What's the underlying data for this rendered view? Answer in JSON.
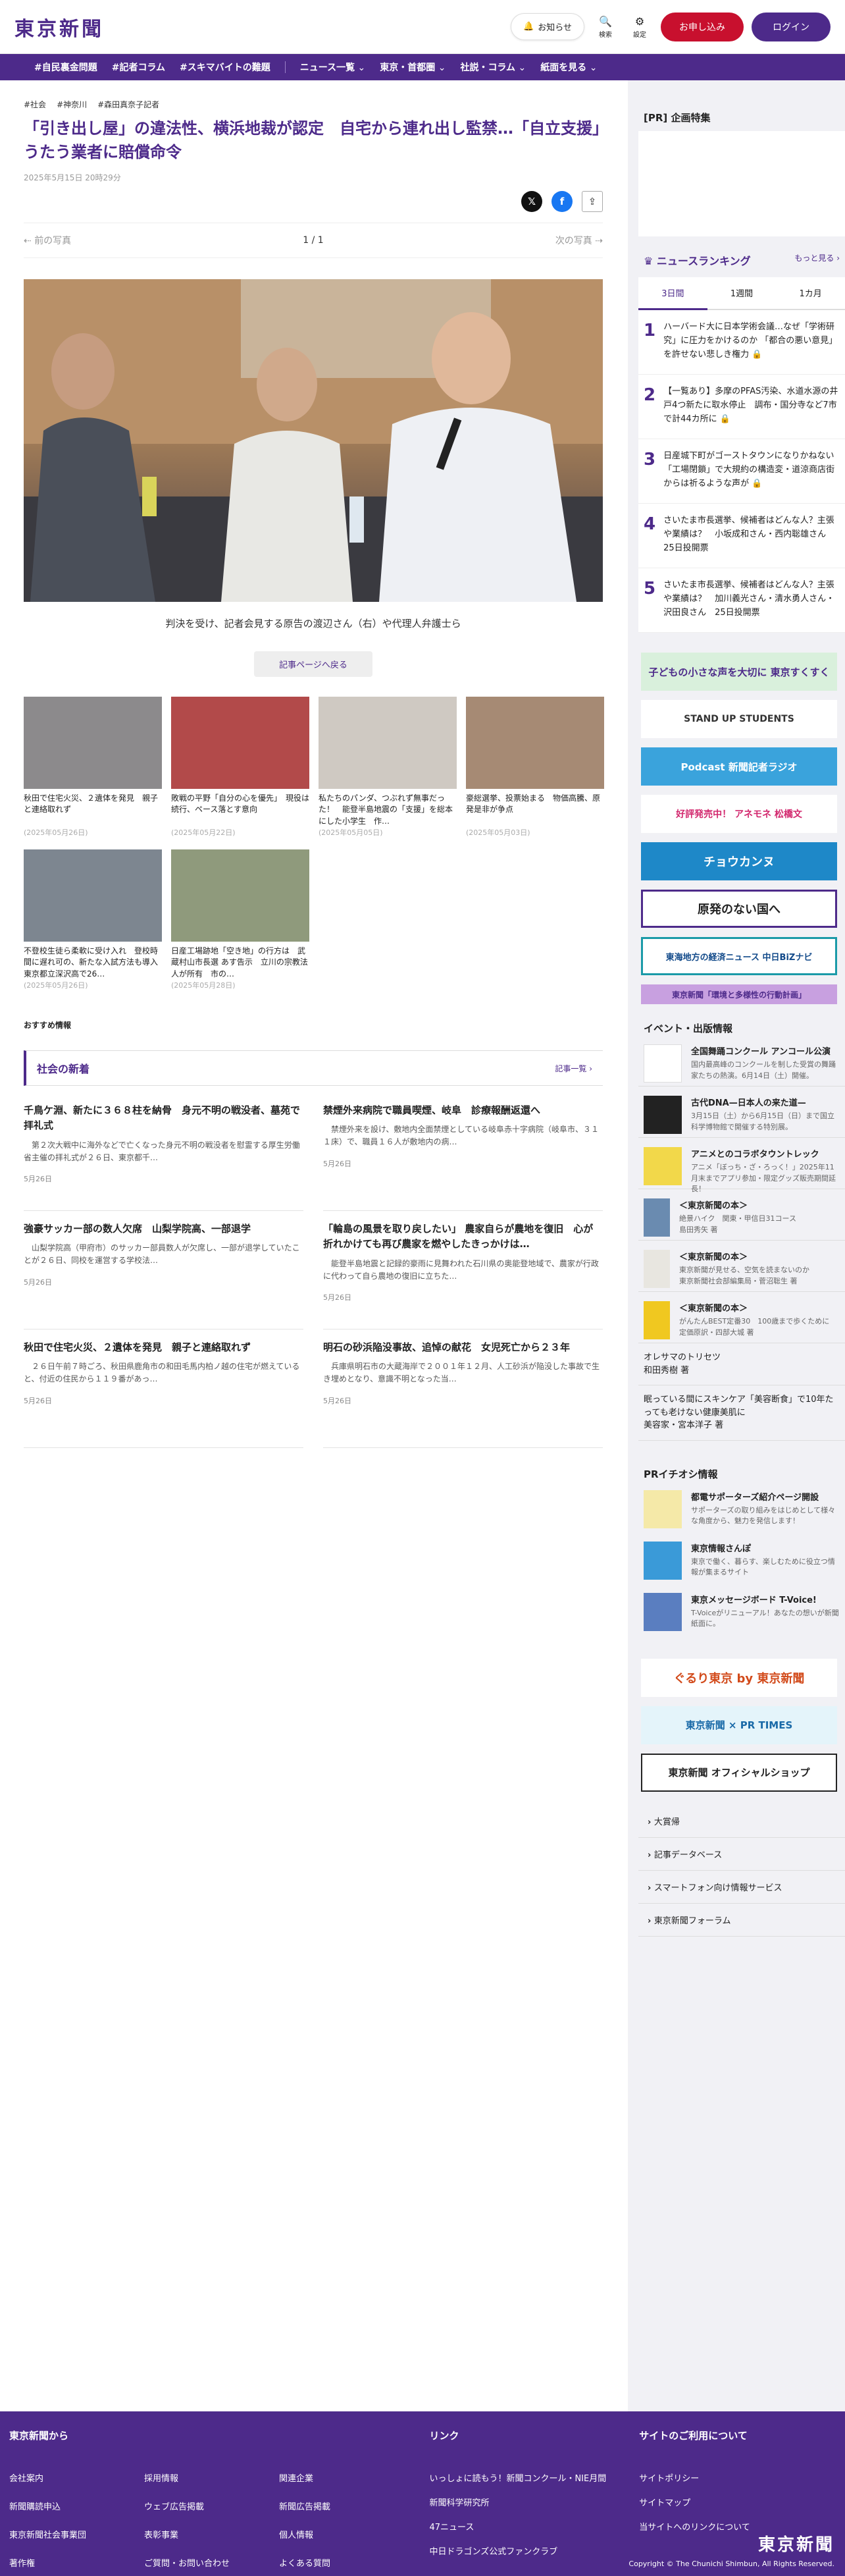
{
  "header": {
    "logo": "東京新聞",
    "notice": "お知らせ",
    "search": "検索",
    "settings": "設定",
    "apply": "お申し込み",
    "login": "ログイン"
  },
  "nav": {
    "items": [
      "#自民裏金問題",
      "#記者コラム",
      "#スキマバイトの難題",
      "ニュース一覧",
      "東京・首都圏",
      "社説・コラム",
      "紙面を見る"
    ]
  },
  "article": {
    "tags": [
      "#社会",
      "#神奈川",
      "#森田真奈子記者"
    ],
    "title": "「引き出し屋」の違法性、横浜地裁が認定　自宅から連れ出し監禁…「自立支援」うたう業者に賠償命令",
    "date": "2025年5月15日 20時29分",
    "prev": "前の写真",
    "next": "次の写真",
    "page": "1 / 1",
    "caption": "判決を受け、記者会見する原告の渡辺さん（右）や代理人弁護士ら",
    "back": "記事ページへ戻る",
    "related": [
      {
        "title": "秋田で住宅火災、２遺体を発見　親子と連絡取れず",
        "date": "(2025年05月26日)"
      },
      {
        "title": "敗戦の平野「自分の心を優先」　現役は続行、ペース落とす意向",
        "date": "(2025年05月22日)"
      },
      {
        "title": "私たちのパンダ、つぶれず無事だった！　能登半島地震の「支援」を総本にした小学生　作…",
        "date": "(2025年05月05日)"
      },
      {
        "title": "豪総選挙、投票始まる　物価高騰、原発是非が争点",
        "date": "(2025年05月03日)"
      },
      {
        "title": "不登校生徒ら柔軟に受け入れ　登校時間に遅れ可の、新たな入試方法も導入　東京都立深沢高で26…",
        "date": "(2025年05月26日)"
      },
      {
        "title": "日産工場跡地「空き地」の行方は　武蔵村山市長選 あす告示　立川の宗教法人が所有　市の…",
        "date": "(2025年05月28日)"
      }
    ],
    "recommend": "おすすめ情報"
  },
  "latest": {
    "heading": "社会の新着",
    "more": "記事一覧",
    "items": [
      {
        "title": "千鳥ケ淵、新たに３６８柱を納骨　身元不明の戦没者、墓苑で拝礼式",
        "body": "　第２次大戦中に海外などで亡くなった身元不明の戦没者を慰霊する厚生労働省主催の拝礼式が２６日、東京都千…",
        "date": "5月26日"
      },
      {
        "title": "禁煙外来病院で職員喫煙、岐阜　診療報酬返還へ",
        "body": "　禁煙外来を設け、敷地内全面禁煙としている岐阜赤十字病院（岐阜市、３１１床）で、職員１６人が敷地内の病…",
        "date": "5月26日"
      },
      {
        "title": "強豪サッカー部の数人欠席　山梨学院高、一部退学",
        "body": "　山梨学院高（甲府市）のサッカー部員数人が欠席し、一部が退学していたことが２６日、同校を運営する学校法…",
        "date": "5月26日"
      },
      {
        "title": "「輪島の風景を取り戻したい」 農家自らが農地を復旧　心が折れかけても再び農家を燃やしたきっかけは…",
        "body": "　能登半島地震と記録的豪雨に見舞われた石川県の奥能登地域で、農家が行政に代わって自ら農地の復旧に立ちた…",
        "date": "5月26日"
      },
      {
        "title": "秋田で住宅火災、２遺体を発見　親子と連絡取れず",
        "body": "　２６日午前７時ごろ、秋田県鹿角市の和田毛馬内柏ノ越の住宅が燃えていると、付近の住民から１１９番があっ…",
        "date": "5月26日"
      },
      {
        "title": "明石の砂浜陥没事故、追悼の献花　女児死亡から２３年",
        "body": "　兵庫県明石市の大蔵海岸で２００１年１２月、人工砂浜が陥没した事故で生き埋めとなり、意識不明となった当…",
        "date": "5月26日"
      }
    ]
  },
  "sidebar": {
    "pr_heading": "[PR] 企画特集",
    "ranking_heading": "ニュースランキング",
    "ranking_more": "もっと見る",
    "tabs": [
      "3日間",
      "1週間",
      "1カ月"
    ],
    "ranking": [
      {
        "n": "1",
        "title": "ハーバード大に日本学術会議…なぜ「学術研究」に圧力をかけるのか 「都合の悪い意見」を許せない悲しき権力 🔒"
      },
      {
        "n": "2",
        "title": "【一覧あり】多摩のPFAS汚染、水道水源の井戸4つ新たに取水停止　調布・国分寺など7市で計44カ所に 🔒"
      },
      {
        "n": "3",
        "title": "日産城下町がゴーストタウンになりかねない 「工場閉鎖」で大規約の構造変・道涼商店街からは祈るような声が 🔒"
      },
      {
        "n": "4",
        "title": "さいたま市長選挙、候補者はどんな人？主張や業績は？　小坂成和さん・西内聡雄さん　25日投開票"
      },
      {
        "n": "5",
        "title": "さいたま市長選挙、候補者はどんな人？主張や業績は？　加川義光さん・清水勇人さん・沢田良さん　25日投開票"
      }
    ],
    "banners": [
      "子どもの小さな声を大切に 東京すくすく",
      "STAND UP STUDENTS",
      "Podcast 新聞記者ラジオ",
      "好評発売中！ アネモネ 松橋文",
      "チョウカンヌ",
      "原発のない国へ",
      "東海地方の経済ニュース 中日BiZナビ",
      "東京新聞「環境と多様性の行動計画」"
    ],
    "events_heading": "イベント・出版情報",
    "events": [
      {
        "title": "全国舞踊コンクール アンコール公演",
        "desc": "国内最高峰のコンクールを制した受賞の舞踊家たちの熱演。6月14日（土）開催。"
      },
      {
        "title": "古代DNA—日本人の来た道—",
        "desc": "3月15日（土）から6月15日（日）まで国立科学博物館で開催する特別展。"
      },
      {
        "title": "アニメとのコラボタウントレック",
        "desc": "アニメ「ぼっち・ざ・ろっく！」2025年11月末までアプリ参加・限定グッズ販売期間延長！"
      },
      {
        "title": "＜東京新聞の本＞",
        "desc": "絶景ハイク　関東・甲信日31コース\n島田秀矢 著"
      },
      {
        "title": "＜東京新聞の本＞",
        "desc": "東京新聞が見せる、空気を読まないのか\n東京新聞社会部編集局・菅沼聡生 著"
      },
      {
        "title": "＜東京新聞の本＞",
        "desc": "がんたんBEST定番30　100歳まで歩くために\n定価原訳・四部大城 著"
      }
    ],
    "events_text": [
      "オレサマのトリセツ\n和田秀樹 著",
      "眠っている間にスキンケア「美容断食」で10年たっても老けない健康美肌に\n美容家・宮本洋子 著"
    ],
    "pick_heading": "PRイチオシ情報",
    "picks": [
      {
        "title": "都電サポーターズ紹介ページ開設",
        "desc": "サポーターズの取り組みをはじめとして様々な角度から、魅力を発信します！"
      },
      {
        "title": "東京情報さんぽ",
        "desc": "東京で働く、暮らす、楽しむために役立つ情報が集まるサイト"
      },
      {
        "title": "東京メッセージボード T-Voice!",
        "desc": "T-Voiceがリニューアル！あなたの想いが新聞紙面に。"
      }
    ],
    "banners2": [
      "ぐるり東京 by 東京新聞",
      "東京新聞 × PR TIMES",
      "東京新聞 オフィシャルショップ"
    ],
    "links": [
      "大賞帰",
      "記事データベース",
      "スマートフォン向け情報サービス",
      "東京新聞フォーラム"
    ]
  },
  "footer": {
    "col1": {
      "heading": "東京新聞から",
      "links": [
        "会社案内",
        "採用情報",
        "関連企業",
        "新聞購読申込",
        "ウェブ広告掲載",
        "新聞広告掲載",
        "東京新聞社会事業団",
        "表彰事業",
        "個人情報",
        "著作権",
        "ご質問・お問い合わせ",
        "よくある質問"
      ]
    },
    "col2": {
      "heading": "リンク",
      "links": [
        "いっしょに読もう！新聞コンクール・NIE月間",
        "新聞科学研究所",
        "47ニュース",
        "中日ドラゴンズ公式ファンクラブ"
      ]
    },
    "col3": {
      "heading": "サイトのご利用について",
      "links": [
        "サイトポリシー",
        "サイトマップ",
        "当サイトへのリンクについて"
      ]
    },
    "logo": "東京新聞",
    "copyright": "Copyright © The Chunichi Shimbun, All Rights Reserved."
  },
  "colors": {
    "brand": "#4d2a8a",
    "red": "#c8102e"
  }
}
